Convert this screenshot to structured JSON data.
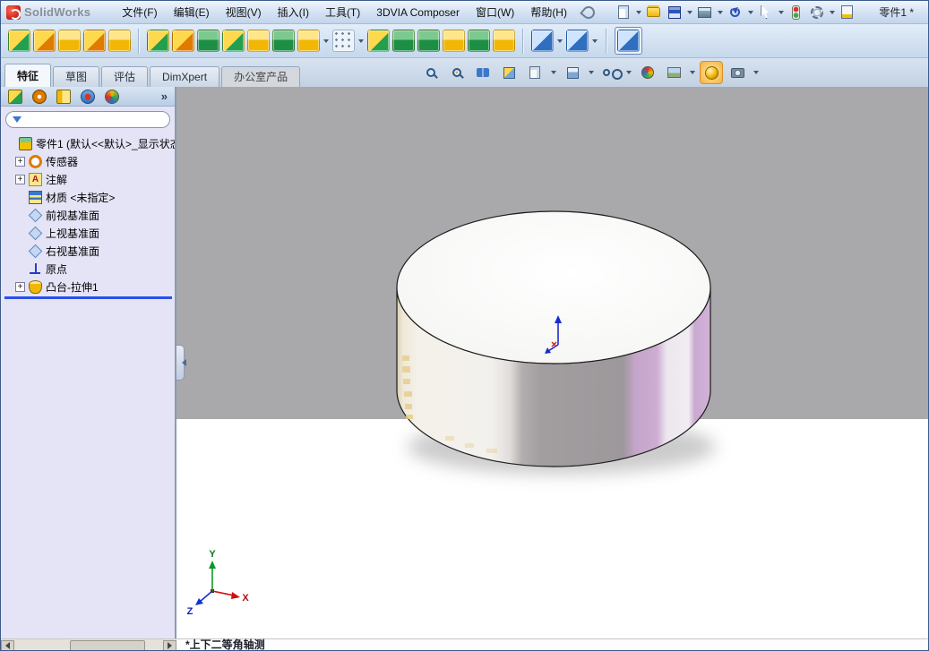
{
  "window": {
    "app_title": "SolidWorks",
    "doc_label": "零件1 *"
  },
  "menu": {
    "items": [
      "文件(F)",
      "编辑(E)",
      "视图(V)",
      "插入(I)",
      "工具(T)",
      "3DVIA Composer",
      "窗口(W)",
      "帮助(H)"
    ]
  },
  "quick_toolbar": {
    "icons": [
      "new-document-icon",
      "open-icon",
      "save-icon",
      "print-icon",
      "undo-icon",
      "select-cursor-icon",
      "rebuild-icon",
      "options-icon",
      "file-properties-icon"
    ]
  },
  "feature_toolbar": {
    "icons": [
      "extruded-boss-icon",
      "revolved-boss-icon",
      "swept-boss-icon",
      "lofted-boss-icon",
      "boundary-boss-icon",
      "extruded-cut-icon",
      "hole-wizard-icon",
      "revolved-cut-icon",
      "swept-cut-icon",
      "lofted-cut-icon",
      "boundary-cut-icon",
      "fillet-icon",
      "linear-pattern-icon",
      "rib-icon",
      "draft-icon",
      "shell-icon",
      "wrap-icon",
      "dome-icon",
      "mirror-icon",
      "reference-geometry-icon",
      "curves-icon",
      "instant3d-icon"
    ]
  },
  "command_tabs": {
    "items": [
      "特征",
      "草图",
      "评估",
      "DimXpert",
      "办公室产品"
    ],
    "active": "特征"
  },
  "view_toolbar": {
    "icons": [
      "zoom-fit-icon",
      "zoom-area-icon",
      "previous-view-icon",
      "section-view-icon",
      "view-orientation-icon",
      "display-style-icon",
      "hide-show-items-icon",
      "edit-appearance-icon",
      "apply-scene-icon",
      "realview-icon",
      "camera-icon"
    ]
  },
  "panel_header": {
    "manager_tabs": [
      "featuremanager-tree",
      "propertymanager",
      "configurationmanager",
      "dimxpertmanager",
      "displaymanager"
    ],
    "more_glyph": "»"
  },
  "feature_manager": {
    "filter_placeholder": "",
    "root_label": "零件1 (默认<<默认>_显示状态",
    "expand_glyph": "+",
    "items": [
      {
        "label": "传感器",
        "expandable": true
      },
      {
        "label": "注解",
        "expandable": true,
        "icon_glyph": "A"
      },
      {
        "label": "材质 <未指定>",
        "expandable": false
      },
      {
        "label": "前视基准面",
        "expandable": false
      },
      {
        "label": "上视基准面",
        "expandable": false
      },
      {
        "label": "右视基准面",
        "expandable": false
      },
      {
        "label": "原点",
        "expandable": false
      },
      {
        "label": "凸台-拉伸1",
        "expandable": true
      }
    ]
  },
  "viewport": {
    "triad": {
      "x": "X",
      "y": "Y",
      "z": "Z"
    }
  },
  "status_bar": {
    "view_name": "*上下二等角轴测"
  },
  "colors": {
    "viewport_gray": "#a9a9ab",
    "panel_bg": "#e4e4f6",
    "rollback_blue": "#2b50e8",
    "band_purple": "#c9a5cc",
    "band_gray": "#9c989b",
    "accent_yellow": "#f2c200",
    "accent_green": "#1f9e4c"
  }
}
